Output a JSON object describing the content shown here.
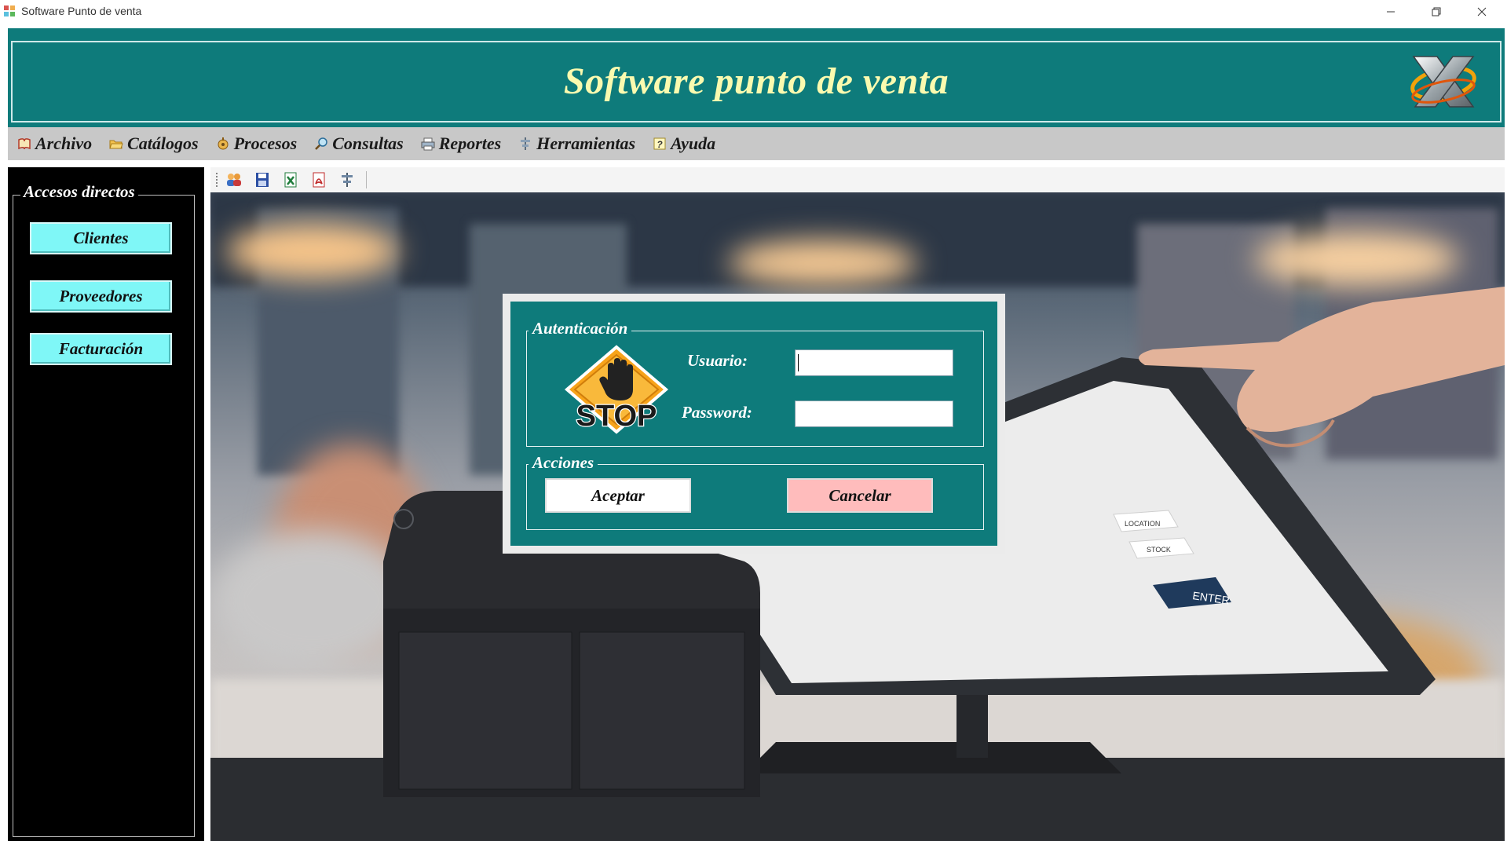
{
  "window": {
    "title": "Software Punto de venta",
    "controls": [
      "minimize-icon",
      "restore-icon",
      "close-icon"
    ]
  },
  "banner": {
    "title": "Software punto de venta",
    "logo_icon": "x-logo-icon",
    "bg_color": "#0e7b7b",
    "title_color": "#fafaaf"
  },
  "menu": {
    "items": [
      {
        "label": "Archivo",
        "icon": "book-icon"
      },
      {
        "label": "Catálogos",
        "icon": "folder-icon"
      },
      {
        "label": "Procesos",
        "icon": "process-icon"
      },
      {
        "label": "Consultas",
        "icon": "magnifier-icon"
      },
      {
        "label": "Reportes",
        "icon": "printer-icon"
      },
      {
        "label": "Herramientas",
        "icon": "tools-icon"
      },
      {
        "label": "Ayuda",
        "icon": "help-icon"
      }
    ]
  },
  "sidebar": {
    "legend": "Accesos directos",
    "buttons": [
      {
        "label": "Clientes"
      },
      {
        "label": "Proveedores"
      },
      {
        "label": "Facturación"
      }
    ],
    "button_color": "#7ff7f7"
  },
  "toolbar": {
    "buttons": [
      "users-icon",
      "save-icon",
      "excel-icon",
      "pdf-icon",
      "tools-icon"
    ]
  },
  "login": {
    "auth_legend": "Autenticación",
    "stop_text": "STOP",
    "usuario_label": "Usuario:",
    "usuario_value": "",
    "password_label": "Password:",
    "password_value": "",
    "actions_legend": "Acciones",
    "accept_label": "Aceptar",
    "cancel_label": "Cancelar",
    "accept_color": "#ffffff",
    "cancel_color": "#ffbcbc"
  },
  "scene": {
    "screen_key_label": "ENTER",
    "screen_labels": [
      "LOCATION",
      "STOCK"
    ]
  }
}
